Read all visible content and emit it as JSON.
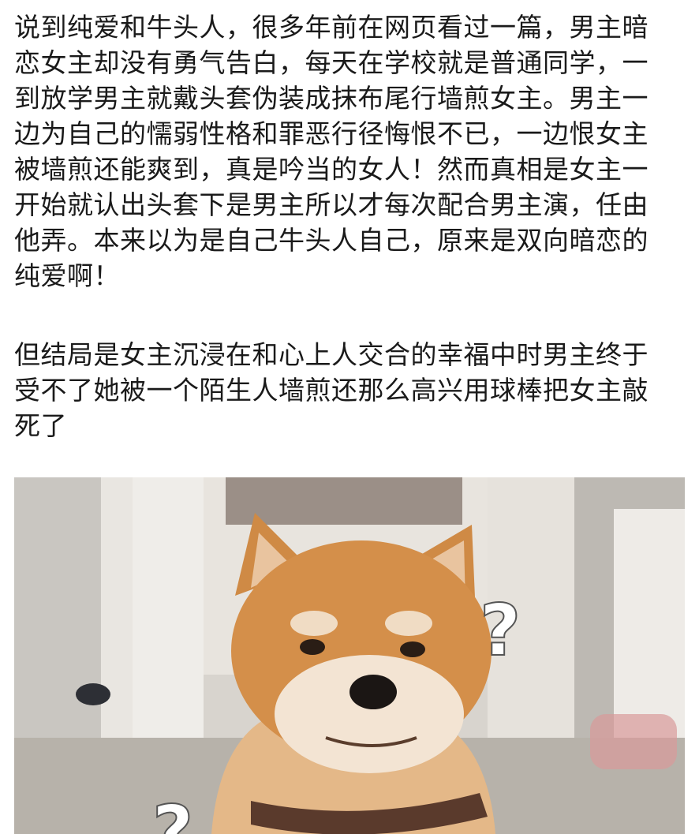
{
  "post": {
    "paragraphs": [
      {
        "lines": [
          "说到纯爱和牛头人，很多年前在网页看过一篇，男主暗",
          "恋女主却没有勇气告白，每天在学校就是普通同学，一",
          "到放学男主就戴头套伪装成抹布尾行墙煎女主。男主一",
          "边为自己的懦弱性格和罪恶行径悔恨不已，一边恨女主",
          "被墙煎还能爽到，真是吟当的女人！然而真相是女主一",
          "开始就认出头套下是男主所以才每次配合男主演，任由",
          "他弄。本来以为是自己牛头人自己，原来是双向暗恋的",
          "纯爱啊！"
        ]
      },
      {
        "lines": [
          "但结局是女主沉浸在和心上人交合的幸福中时男主终于",
          "受不了她被一个陌生人墙煎还那么高兴用球棒把女主敲",
          "死了"
        ]
      }
    ],
    "image": {
      "subject": "shiba-inu-confused-meme",
      "overlay_marks": [
        "?",
        "?"
      ]
    }
  }
}
